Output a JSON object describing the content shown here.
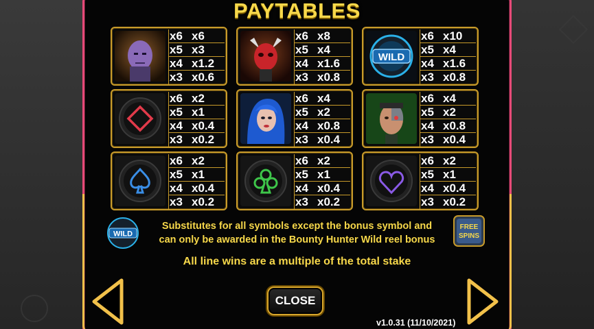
{
  "title": "PAYTABLES",
  "symbols": [
    {
      "name": "villain-purple",
      "pays": [
        {
          "count": "x6",
          "value": "x6"
        },
        {
          "count": "x5",
          "value": "x3"
        },
        {
          "count": "x4",
          "value": "x1.2"
        },
        {
          "count": "x3",
          "value": "x0.6"
        }
      ]
    },
    {
      "name": "villain-red-skull",
      "pays": [
        {
          "count": "x6",
          "value": "x8"
        },
        {
          "count": "x5",
          "value": "x4"
        },
        {
          "count": "x4",
          "value": "x1.6"
        },
        {
          "count": "x3",
          "value": "x0.8"
        }
      ]
    },
    {
      "name": "wild",
      "label": "WILD",
      "pays": [
        {
          "count": "x6",
          "value": "x10"
        },
        {
          "count": "x5",
          "value": "x4"
        },
        {
          "count": "x4",
          "value": "x1.6"
        },
        {
          "count": "x3",
          "value": "x0.8"
        }
      ]
    },
    {
      "name": "diamond",
      "pays": [
        {
          "count": "x6",
          "value": "x2"
        },
        {
          "count": "x5",
          "value": "x1"
        },
        {
          "count": "x4",
          "value": "x0.4"
        },
        {
          "count": "x3",
          "value": "x0.2"
        }
      ]
    },
    {
      "name": "blue-hair-woman",
      "pays": [
        {
          "count": "x6",
          "value": "x4"
        },
        {
          "count": "x5",
          "value": "x2"
        },
        {
          "count": "x4",
          "value": "x0.8"
        },
        {
          "count": "x3",
          "value": "x0.4"
        }
      ]
    },
    {
      "name": "cyborg-man",
      "pays": [
        {
          "count": "x6",
          "value": "x4"
        },
        {
          "count": "x5",
          "value": "x2"
        },
        {
          "count": "x4",
          "value": "x0.8"
        },
        {
          "count": "x3",
          "value": "x0.4"
        }
      ]
    },
    {
      "name": "spade",
      "pays": [
        {
          "count": "x6",
          "value": "x2"
        },
        {
          "count": "x5",
          "value": "x1"
        },
        {
          "count": "x4",
          "value": "x0.4"
        },
        {
          "count": "x3",
          "value": "x0.2"
        }
      ]
    },
    {
      "name": "club",
      "pays": [
        {
          "count": "x6",
          "value": "x2"
        },
        {
          "count": "x5",
          "value": "x1"
        },
        {
          "count": "x4",
          "value": "x0.4"
        },
        {
          "count": "x3",
          "value": "x0.2"
        }
      ]
    },
    {
      "name": "heart",
      "pays": [
        {
          "count": "x6",
          "value": "x2"
        },
        {
          "count": "x5",
          "value": "x1"
        },
        {
          "count": "x4",
          "value": "x0.4"
        },
        {
          "count": "x3",
          "value": "x0.2"
        }
      ]
    }
  ],
  "wild_label": "WILD",
  "free_spins_label": "FREE SPINS",
  "description_line1": "Substitutes for all symbols except the bonus symbol and",
  "description_line2": "can only be awarded in the Bounty Hunter Wild reel bonus",
  "note": "All line wins are a multiple of the total stake",
  "close_label": "CLOSE",
  "version": "v1.0.31 (11/10/2021)",
  "colors": {
    "accent": "#f7d84a",
    "frame": "#c89b2a",
    "border_pink": "#e74a78",
    "diamond": "#e23a4a",
    "spade": "#3a8ee6",
    "club": "#3ec64a",
    "heart": "#8a5ae6"
  }
}
